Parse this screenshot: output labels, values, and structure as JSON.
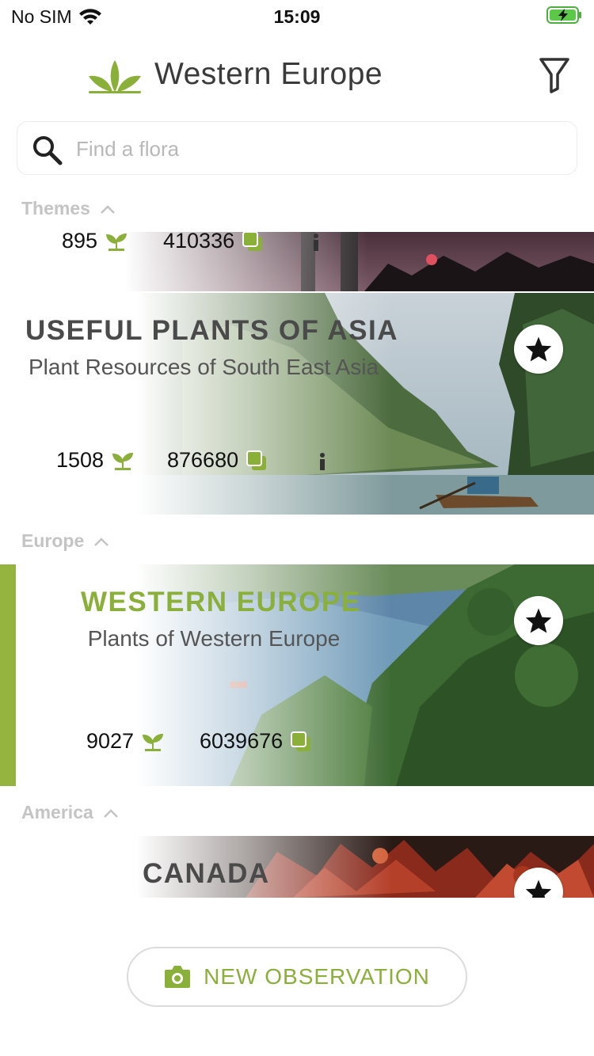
{
  "status": {
    "carrier": "No SIM",
    "time": "15:09"
  },
  "header": {
    "title": "Western Europe"
  },
  "search": {
    "placeholder": "Find a flora"
  },
  "sections": {
    "themes": "Themes",
    "europe": "Europe",
    "america": "America"
  },
  "cards": {
    "prev": {
      "species": "895",
      "observations": "410336"
    },
    "asia": {
      "title": "USEFUL PLANTS OF ASIA",
      "subtitle": "Plant Resources of South East Asia",
      "species": "1508",
      "observations": "876680"
    },
    "western_europe": {
      "title": "WESTERN EUROPE",
      "subtitle": "Plants of Western Europe",
      "species": "9027",
      "observations": "6039676"
    },
    "canada": {
      "title": "CANADA"
    }
  },
  "actions": {
    "new_observation": "NEW OBSERVATION"
  },
  "colors": {
    "accent": "#8ab03a",
    "selected_bar": "#94b43f"
  },
  "icons": [
    "wifi-icon",
    "battery-charging-icon",
    "plantnet-logo-icon",
    "filter-icon",
    "search-icon",
    "chevron-up-icon",
    "seedling-icon",
    "images-icon",
    "info-icon",
    "star-icon",
    "camera-icon"
  ]
}
